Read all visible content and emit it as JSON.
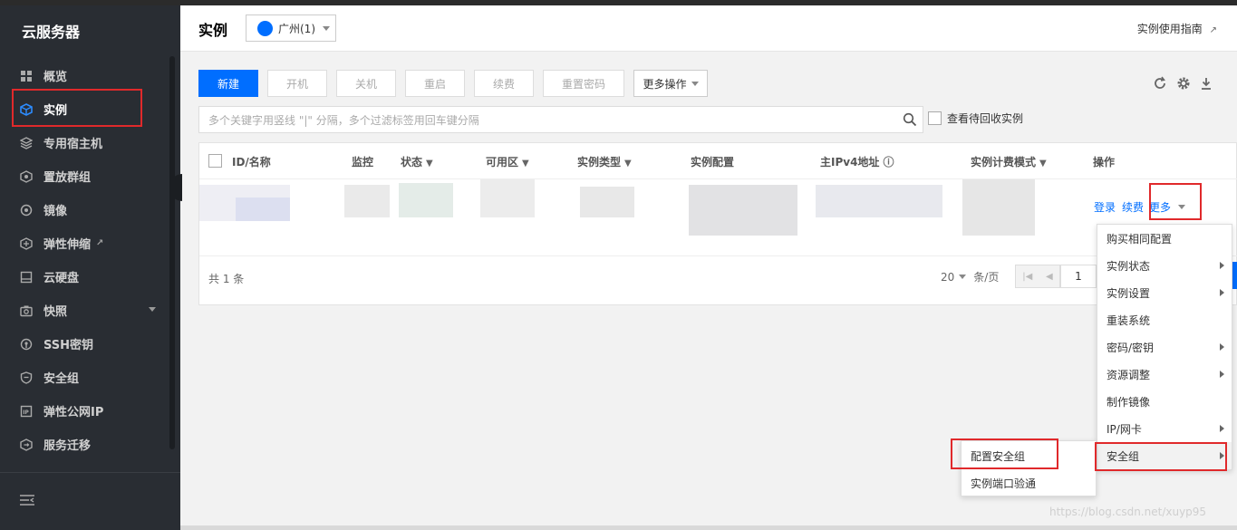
{
  "sidebar": {
    "title": "云服务器",
    "items": [
      {
        "label": "概览",
        "icon": "grid-icon"
      },
      {
        "label": "实例",
        "icon": "cube-icon",
        "active": true
      },
      {
        "label": "专用宿主机",
        "icon": "host-icon"
      },
      {
        "label": "置放群组",
        "icon": "group-icon"
      },
      {
        "label": "镜像",
        "icon": "disc-icon"
      },
      {
        "label": "弹性伸缩",
        "icon": "scale-icon",
        "external": true
      },
      {
        "label": "云硬盘",
        "icon": "disk-icon"
      },
      {
        "label": "快照",
        "icon": "camera-icon",
        "expandable": true
      },
      {
        "label": "SSH密钥",
        "icon": "key-icon"
      },
      {
        "label": "安全组",
        "icon": "shield-icon"
      },
      {
        "label": "弹性公网IP",
        "icon": "ip-icon"
      },
      {
        "label": "服务迁移",
        "icon": "migrate-icon"
      }
    ]
  },
  "header": {
    "title": "实例",
    "region": "广州(1)",
    "guide_link": "实例使用指南"
  },
  "toolbar": {
    "new": "新建",
    "start": "开机",
    "stop": "关机",
    "restart": "重启",
    "renew": "续费",
    "reset_password": "重置密码",
    "more_actions": "更多操作"
  },
  "search": {
    "placeholder": "多个关键字用竖线 \"|\" 分隔，多个过滤标签用回车键分隔",
    "recycle_label": "查看待回收实例"
  },
  "table": {
    "headers": {
      "id_name": "ID/名称",
      "monitor": "监控",
      "status": "状态",
      "zone": "可用区",
      "instance_type": "实例类型",
      "config": "实例配置",
      "ipv4": "主IPv4地址",
      "billing": "实例计费模式",
      "actions": "操作"
    },
    "row_actions": {
      "login": "登录",
      "renew": "续费",
      "more": "更多"
    },
    "footer": {
      "total": "共 1 条",
      "page_size": "20",
      "per_page": "条/页",
      "page": "1"
    }
  },
  "more_menu": {
    "items": [
      {
        "label": "购买相同配置",
        "submenu": false
      },
      {
        "label": "实例状态",
        "submenu": true
      },
      {
        "label": "实例设置",
        "submenu": true
      },
      {
        "label": "重装系统",
        "submenu": false
      },
      {
        "label": "密码/密钥",
        "submenu": true
      },
      {
        "label": "资源调整",
        "submenu": true
      },
      {
        "label": "制作镜像",
        "submenu": false
      },
      {
        "label": "IP/网卡",
        "submenu": true
      },
      {
        "label": "安全组",
        "submenu": true,
        "hover": true
      }
    ]
  },
  "security_submenu": {
    "items": [
      {
        "label": "配置安全组"
      },
      {
        "label": "实例端口验通"
      }
    ]
  },
  "watermark": "https://blog.csdn.net/xuyp95",
  "colors": {
    "accent": "#006eff",
    "sidebar_bg": "#292d33",
    "highlight": "#e0292b"
  }
}
